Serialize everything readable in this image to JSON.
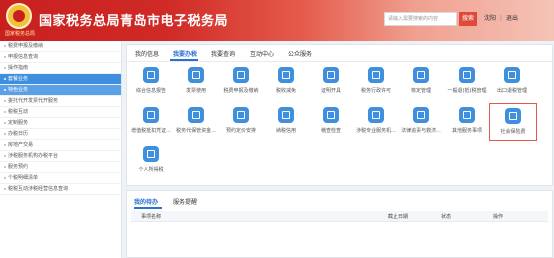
{
  "header": {
    "logo_text": "国家税务总局",
    "title": "国家税务总局青岛市电子税务局",
    "search_placeholder": "请输入需要搜索的内容",
    "search_button": "搜索",
    "user_name": "沈阳",
    "logout": "退出"
  },
  "sidebar": {
    "items": [
      {
        "label": "税费申报及缴纳",
        "state": "normal"
      },
      {
        "label": "申报信息查询",
        "state": "normal"
      },
      {
        "label": "操作指南",
        "state": "normal"
      },
      {
        "label": "套餐业务",
        "state": "active"
      },
      {
        "label": "特色业务",
        "state": "sub-active"
      },
      {
        "label": "委托代开发票代开服务",
        "state": "normal"
      },
      {
        "label": "税税互动",
        "state": "normal"
      },
      {
        "label": "定制服务",
        "state": "normal"
      },
      {
        "label": "办税日历",
        "state": "normal"
      },
      {
        "label": "房地产交易",
        "state": "normal"
      },
      {
        "label": "涉税服务机构办税平台",
        "state": "normal"
      },
      {
        "label": "服务预约",
        "state": "normal"
      },
      {
        "label": "个税明细清单",
        "state": "normal"
      },
      {
        "label": "税税互动涉税经营信息查询",
        "state": "normal"
      }
    ]
  },
  "main_tabs": {
    "items": [
      "我的信息",
      "我要办税",
      "我要查询",
      "互动中心",
      "公众服务"
    ],
    "active": "我要办税"
  },
  "grid": {
    "row1": [
      "综合信息报告",
      "发票使用",
      "税费申报及缴纳",
      "税收减免",
      "证明开具",
      "税务行政许可",
      "核定管理",
      "一般退(抵)税管理",
      "出口退税管理"
    ],
    "row2": [
      "增值税抵扣凭证...",
      "税务代保管资金...",
      "预约定价安排",
      "纳税信用",
      "稽查检查",
      "涉税专业服务机...",
      "法律追责与救济...",
      "其他服务事项",
      "社会保险费"
    ],
    "row3": [
      "个人所得税"
    ],
    "highlighted": "社会保险费"
  },
  "todo": {
    "tabs": [
      "我的待办",
      "服务提醒"
    ],
    "active": "我的待办",
    "columns": [
      "事项名称",
      "截止日期",
      "状态",
      "操作"
    ]
  },
  "colors": {
    "header_red": "#c8201f",
    "icon_blue": "#3e8fde",
    "active_blue": "#2a6fd1",
    "highlight_border": "#e8554a"
  }
}
